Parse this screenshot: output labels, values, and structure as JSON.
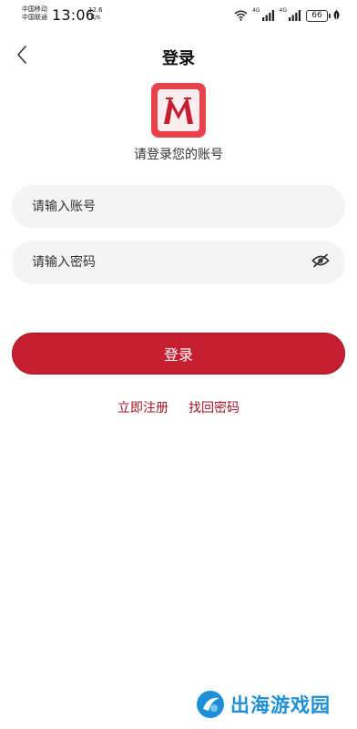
{
  "status_bar": {
    "carrier_1": "中国移动",
    "carrier_2": "中国联通",
    "time": "13:06",
    "speed_value": "12.6",
    "speed_unit": "K/s",
    "net_label_1": "4G",
    "net_label_2": "4G",
    "battery": "66"
  },
  "header": {
    "title": "登录"
  },
  "prompt": "请登录您的账号",
  "form": {
    "account_placeholder": "请输入账号",
    "account_value": "",
    "password_placeholder": "请输入密码",
    "password_value": ""
  },
  "login_button_label": "登录",
  "links": {
    "register": "立即注册",
    "recover_password": "找回密码"
  },
  "watermark": {
    "text": "出海游戏园"
  },
  "colors": {
    "primary": "#c51f31",
    "logo_red": "#e8424b",
    "link": "#a31626",
    "field_bg": "#f4f4f4",
    "watermark": "#1e8fd6"
  }
}
